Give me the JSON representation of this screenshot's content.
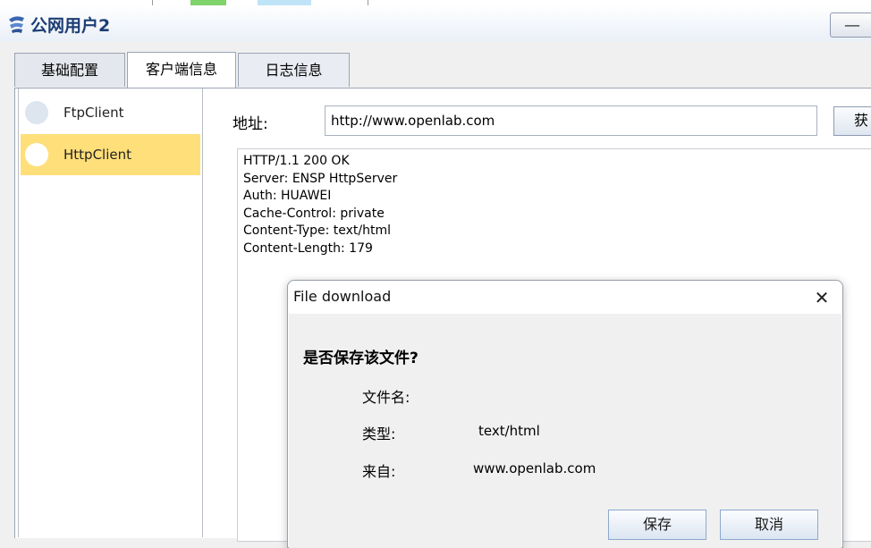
{
  "window": {
    "title": "公网用户2",
    "minimize_label": "—",
    "icon": "enterprise-user-icon"
  },
  "tabs": [
    {
      "label": "基础配置"
    },
    {
      "label": "客户端信息",
      "active": true
    },
    {
      "label": "日志信息"
    }
  ],
  "sidebar": {
    "items": [
      {
        "label": "FtpClient"
      },
      {
        "label": "HttpClient",
        "selected": true
      }
    ]
  },
  "address": {
    "label": "地址:",
    "value": "http://www.openlab.com",
    "get_button": "获"
  },
  "response": {
    "lines": [
      "HTTP/1.1 200 OK",
      "Server: ENSP HttpServer",
      "Auth: HUAWEI",
      "Cache-Control: private",
      "Content-Type: text/html",
      "Content-Length: 179"
    ]
  },
  "dialog": {
    "title": "File download",
    "close": "✕",
    "question": "是否保存该文件?",
    "filename_label": "文件名:",
    "filename_value": "",
    "type_label": "类型:",
    "type_value": "text/html",
    "from_label": "来自:",
    "from_value": "www.openlab.com",
    "save_button": "保存",
    "cancel_button": "取消"
  },
  "colors": {
    "selected_item": "#ffdf7a",
    "title_text": "#1c3e74"
  }
}
